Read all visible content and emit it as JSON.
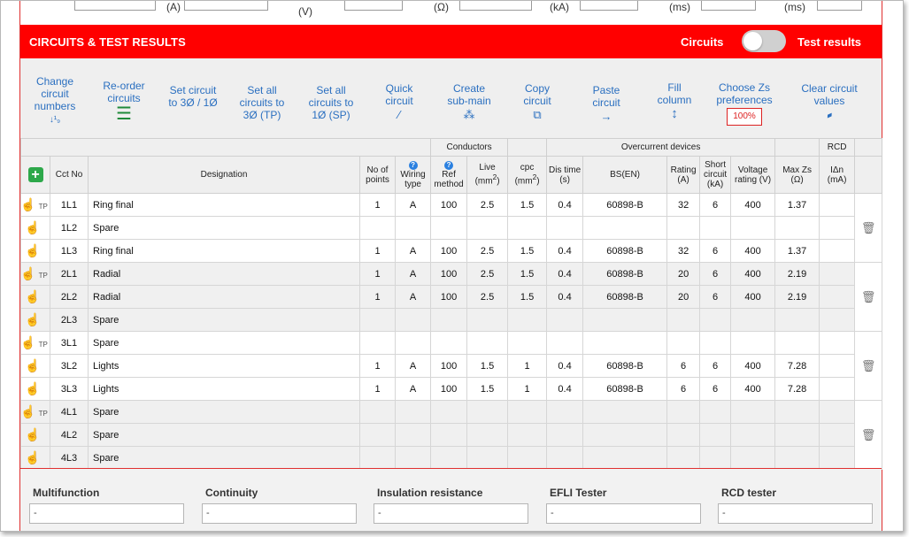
{
  "top_row": {
    "labels": [
      "(A)",
      "(V)",
      "(Ω)",
      "(kA)",
      "(ms)",
      "(ms)"
    ]
  },
  "header": {
    "title": "CIRCUITS & TEST RESULTS",
    "toggle_left": "Circuits",
    "toggle_right": "Test results"
  },
  "toolbar": {
    "items": [
      {
        "label": "Change circuit numbers",
        "icon": "sort-numbers-icon",
        "glyph": "↓¹₉"
      },
      {
        "label": "Re-order circuits",
        "icon": "reorder-icon",
        "glyph": "☰"
      },
      {
        "label": "Set circuit to 3Ø / 1Ø",
        "icon": "",
        "glyph": ""
      },
      {
        "label": "Set all circuits to 3Ø (TP)",
        "icon": "",
        "glyph": ""
      },
      {
        "label": "Set all circuits to 1Ø (SP)",
        "icon": "",
        "glyph": ""
      },
      {
        "label": "Quick circuit",
        "icon": "wand-icon",
        "glyph": "⁄"
      },
      {
        "label": "Create sub-main",
        "icon": "sitemap-icon",
        "glyph": "⁂"
      },
      {
        "label": "Copy circuit",
        "icon": "copy-icon",
        "glyph": "⧉"
      },
      {
        "label": "Paste circuit",
        "icon": "arrow-right-icon",
        "glyph": "→"
      },
      {
        "label": "Fill column",
        "icon": "arrows-vertical-icon",
        "glyph": "↕"
      },
      {
        "label": "Choose Zs preferences",
        "icon": "",
        "glyph": ""
      },
      {
        "label": "Clear circuit values",
        "icon": "eraser-icon",
        "glyph": "▰"
      }
    ],
    "zs_value": "100%"
  },
  "table": {
    "group_headers": {
      "conductors": "Conductors",
      "overcurrent": "Overcurrent devices",
      "rcd": "RCD"
    },
    "columns": {
      "cct_no": "Cct No",
      "designation": "Designation",
      "no_of_points": "No of points",
      "wiring_type": "Wiring type",
      "ref_method": "Ref method",
      "live": "Live",
      "cpc": "cpc",
      "mm2": "(mm",
      "sup2": "2",
      "close_paren": ")",
      "dis_time": "Dis time (s)",
      "bs_en": "BS(EN)",
      "rating": "Rating (A)",
      "short_circuit": "Short circuit (kA)",
      "voltage_rating": "Voltage rating (V)",
      "max_zs": "Max Zs (Ω)",
      "idn": "IΔn (mA)"
    },
    "tp_label": "TP",
    "rows": [
      {
        "cct": "1L1",
        "tp": true,
        "desig": "Ring final",
        "points": "1",
        "wiring": "A",
        "ref": "100",
        "live": "2.5",
        "cpc": "1.5",
        "dis": "0.4",
        "bs": "60898-B",
        "rating": "32",
        "sc": "6",
        "volt": "400",
        "zs": "1.37",
        "idn": ""
      },
      {
        "cct": "1L2",
        "tp": false,
        "desig": "Spare",
        "points": "",
        "wiring": "",
        "ref": "",
        "live": "",
        "cpc": "",
        "dis": "",
        "bs": "",
        "rating": "",
        "sc": "",
        "volt": "",
        "zs": "",
        "idn": ""
      },
      {
        "cct": "1L3",
        "tp": false,
        "desig": "Ring final",
        "points": "1",
        "wiring": "A",
        "ref": "100",
        "live": "2.5",
        "cpc": "1.5",
        "dis": "0.4",
        "bs": "60898-B",
        "rating": "32",
        "sc": "6",
        "volt": "400",
        "zs": "1.37",
        "idn": ""
      },
      {
        "cct": "2L1",
        "tp": true,
        "desig": "Radial",
        "points": "1",
        "wiring": "A",
        "ref": "100",
        "live": "2.5",
        "cpc": "1.5",
        "dis": "0.4",
        "bs": "60898-B",
        "rating": "20",
        "sc": "6",
        "volt": "400",
        "zs": "2.19",
        "idn": ""
      },
      {
        "cct": "2L2",
        "tp": false,
        "desig": "Radial",
        "points": "1",
        "wiring": "A",
        "ref": "100",
        "live": "2.5",
        "cpc": "1.5",
        "dis": "0.4",
        "bs": "60898-B",
        "rating": "20",
        "sc": "6",
        "volt": "400",
        "zs": "2.19",
        "idn": ""
      },
      {
        "cct": "2L3",
        "tp": false,
        "desig": "Spare",
        "points": "",
        "wiring": "",
        "ref": "",
        "live": "",
        "cpc": "",
        "dis": "",
        "bs": "",
        "rating": "",
        "sc": "",
        "volt": "",
        "zs": "",
        "idn": ""
      },
      {
        "cct": "3L1",
        "tp": true,
        "desig": "Spare",
        "points": "",
        "wiring": "",
        "ref": "",
        "live": "",
        "cpc": "",
        "dis": "",
        "bs": "",
        "rating": "",
        "sc": "",
        "volt": "",
        "zs": "",
        "idn": ""
      },
      {
        "cct": "3L2",
        "tp": false,
        "desig": "Lights",
        "points": "1",
        "wiring": "A",
        "ref": "100",
        "live": "1.5",
        "cpc": "1",
        "dis": "0.4",
        "bs": "60898-B",
        "rating": "6",
        "sc": "6",
        "volt": "400",
        "zs": "7.28",
        "idn": ""
      },
      {
        "cct": "3L3",
        "tp": false,
        "desig": "Lights",
        "points": "1",
        "wiring": "A",
        "ref": "100",
        "live": "1.5",
        "cpc": "1",
        "dis": "0.4",
        "bs": "60898-B",
        "rating": "6",
        "sc": "6",
        "volt": "400",
        "zs": "7.28",
        "idn": ""
      },
      {
        "cct": "4L1",
        "tp": true,
        "desig": "Spare",
        "points": "",
        "wiring": "",
        "ref": "",
        "live": "",
        "cpc": "",
        "dis": "",
        "bs": "",
        "rating": "",
        "sc": "",
        "volt": "",
        "zs": "",
        "idn": ""
      },
      {
        "cct": "4L2",
        "tp": false,
        "desig": "Spare",
        "points": "",
        "wiring": "",
        "ref": "",
        "live": "",
        "cpc": "",
        "dis": "",
        "bs": "",
        "rating": "",
        "sc": "",
        "volt": "",
        "zs": "",
        "idn": ""
      },
      {
        "cct": "4L3",
        "tp": false,
        "desig": "Spare",
        "points": "",
        "wiring": "",
        "ref": "",
        "live": "",
        "cpc": "",
        "dis": "",
        "bs": "",
        "rating": "",
        "sc": "",
        "volt": "",
        "zs": "",
        "idn": ""
      }
    ]
  },
  "testers": [
    {
      "label": "Multifunction",
      "value": "-"
    },
    {
      "label": "Continuity",
      "value": "-"
    },
    {
      "label": "Insulation resistance",
      "value": "-"
    },
    {
      "label": "EFLI Tester",
      "value": "-"
    },
    {
      "label": "RCD tester",
      "value": "-"
    }
  ],
  "colors": {
    "header_red": "#ff0000",
    "link_blue": "#2a6fc0",
    "add_green": "#2da84a"
  }
}
